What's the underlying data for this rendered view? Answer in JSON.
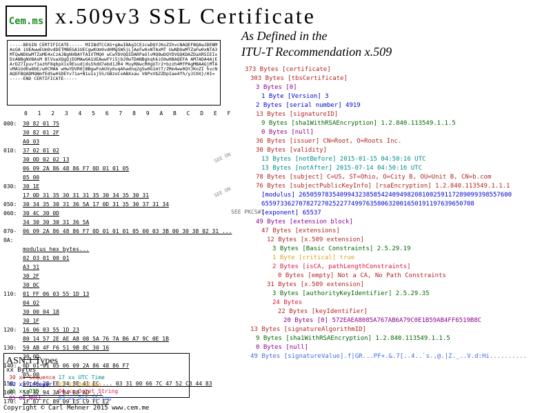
{
  "logo": {
    "text": "Cem.ms"
  },
  "title": "x.509v3 SSL Certificate",
  "subtitle1": "As Defined in the",
  "subtitle2": "ITU-T Recommendation x.509",
  "cert_pem": "-----BEGIN CERTIFICATE-----\nMIIBdTCCAS+gAwIBAgICEzcwDQYJKoZIhvcNAQEFBQAwJDENMAsGA\n1UEAwwEUm9vdDETMBEGA1UECgwKUm9vdHMgSW5jLjAeFw0xNTAxMT\nUwNDUwMTZaFw0xNTA3MTQwNDUwMTZaME4xCzAJBgNVBAYTA1VTMQ0\nwCwYDVQQIDARPaGlvMQ8wDQYDVQQKDAZDaXR5IEIxDzANBgNVBAsM\nBlVuaXQgQjEOMAwGA1UEAwwFYi5jb20wTDANBgkqhkiG9w0BAQEFA\nAM7ADA4AjEArDZ7Ipuvf1azhF8qbpXis9EsudjdsShdd7ebd1JR4\nMuyRNwcR0gUTr2+bzzh4MfPAgMBAAGjMTAvMA1UdEw8bE/w0CMAA\nwHwYDVR0jBBgwFoAUVy6uqAhadnq2g5w0G1mtT/ZRm4ww0QYJKoZI\nhvcNAQEFBQADMQBmfEdSw0SDEYv71a+N1u1sj55/GBzoCxABXxau\nV8PxVbZZDpIae4fh/yJC0X}/0I=\n-----END CERTIFICATE-----",
  "hexdump": {
    "header": "0 1 2 3 4 5 6 7 8 9 A B C D E F",
    "rows": [
      {
        "off": "000:",
        "hex": "30 82 01 75"
      },
      {
        "off": "",
        "hex": "         30 82 01 2F"
      },
      {
        "off": "",
        "hex": "                  A0 03"
      },
      {
        "off": "010:",
        "hex": "37                        02 01 02"
      },
      {
        "off": "",
        "hex": "   30 0D                           02 02 13"
      },
      {
        "off": "",
        "hex": "         06 09 2A 86 48 86 F7 0D 01 01 05"
      },
      {
        "off": "",
        "hex": "                                       05 00"
      },
      {
        "off": "030:",
        "hex": "30 1E"
      },
      {
        "off": "",
        "hex": "      17 0D 31 35 30 31 31 35 30 34 35 30 31"
      },
      {
        "off": "050:",
        "hex": "30 34 35 30 31 36 5A    17 0D 31 35 30 37 31 34"
      },
      {
        "off": "060:",
        "hex": "                  30 4C 30 0D"
      },
      {
        "off": "",
        "hex": "34 30 30 30 31 36 5A"
      },
      {
        "off": "070-0A:",
        "hex": "06 09 2A 86 48 86 F7 0D 01 01 01 05 00 03 3B 00 30 38 02 31 ..."
      },
      {
        "off": "",
        "hex": "modulus hex bytes..."
      },
      {
        "off": "",
        "hex": "                              02 03 01 00 01"
      },
      {
        "off": "",
        "hex": "               A3 31"
      },
      {
        "off": "",
        "hex": "                     30 2F"
      },
      {
        "off": "",
        "hex": "                           30 0C"
      },
      {
        "off": "110:",
        "hex": "01 FF         06 03 55 1D 13"
      },
      {
        "off": "",
        "hex": "      04 02"
      },
      {
        "off": "",
        "hex": "            30 00                    04 18"
      },
      {
        "off": "",
        "hex": "                  30 1F"
      },
      {
        "off": "120:",
        "hex": "16               06 03 55 1D 23"
      },
      {
        "off": "",
        "hex": "   80 14 57 2E AE A8 08 5A 76 7A B6 A7 9C 0E 1B"
      },
      {
        "off": "130:",
        "hex": "59 AB 4F F6 51 9B 8C    30 16"
      },
      {
        "off": "",
        "hex": "                        30 0D"
      },
      {
        "off": "140:",
        "hex": "0D 01 01 05       06 09 2A 86 48 86 F7"
      },
      {
        "off": "",
        "hex": "            05 00"
      },
      {
        "off": "150:",
        "hex": "50 46 28 EE 34 8E 41 EC ... 03 31 00 66 7C 47 52 C3 44 83"
      },
      {
        "off": "160:",
        "hex": "58 32 94 3A B4 B8 AD ..."
      },
      {
        "off": "170:",
        "hex": "1F 87 FC 89 09 E5 C9 FC E2"
      }
    ]
  },
  "tree": [
    {
      "t": "373 Bytes [certificate]",
      "c": "seq",
      "i": 0
    },
    {
      "t": "303 Bytes [tbsCertificate]",
      "c": "seq",
      "i": 1
    },
    {
      "t": "3 Bytes [0]",
      "c": "purple",
      "i": 2
    },
    {
      "t": "1 Byte [Version] 3",
      "c": "blue",
      "i": 3
    },
    {
      "t": "2 Bytes [serial number]  4919",
      "c": "blue",
      "i": 2
    },
    {
      "t": "13 Bytes [signatureID]",
      "c": "seq",
      "i": 2
    },
    {
      "t": "9 Bytes [sha1WithRSAEncryption] 1.2.840.113549.1.1.5",
      "c": "green",
      "i": 3
    },
    {
      "t": "0 Bytes [null]",
      "c": "purple",
      "i": 3
    },
    {
      "t": "36 Bytes [issuer] CN=Root, O=Roots Inc.",
      "c": "seq",
      "i": 2
    },
    {
      "t": "30 Bytes [validity]",
      "c": "seq",
      "i": 2
    },
    {
      "t": "13 Bytes [notBefore] 2015-01-15 04:50:16 UTC",
      "c": "teal",
      "i": 3
    },
    {
      "t": "13 Bytes [notAfter] 2015-07-14 04:50:16 UTC",
      "c": "teal",
      "i": 3
    },
    {
      "t": "78 Bytes [subject] C=US, ST=Ohio, O=City B, OU=Unit B, CN=b.com",
      "c": "seq",
      "i": 2
    },
    {
      "t": "76 Bytes [subjectPublicKeyInfo] [rsaEncryption] 1.2.840.113549.1.1.1",
      "c": "seq",
      "i": 2
    },
    {
      "t": "[modulus]  265059783540994323858542409498208100259117289099398557600",
      "c": "blue",
      "i": 3
    },
    {
      "t": "           655973362707827270252277499763580632001650191197639650708",
      "c": "blue",
      "i": 3
    },
    {
      "t": "[exponent] 65537",
      "c": "blue",
      "i": 3
    },
    {
      "t": "49 Bytes [extension block]",
      "c": "purple",
      "i": 2
    },
    {
      "t": "47 Bytes [extensions]",
      "c": "seq",
      "i": 3
    },
    {
      "t": "12 Bytes [x.509 extension]",
      "c": "seq",
      "i": 4
    },
    {
      "t": "3 Bytes [Basic Constraints] 2.5.29.19",
      "c": "green",
      "i": 5
    },
    {
      "t": "1 Byte [critical] true",
      "c": "gold",
      "i": 5
    },
    {
      "t": "2 Bytes [isCA, pathLengthConstraints]",
      "c": "oct",
      "i": 5
    },
    {
      "t": "0 Bytes [empty] Not a CA, No Path Constraints",
      "c": "seq",
      "i": 6
    },
    {
      "t": "31 Bytes [x.509 extension]",
      "c": "seq",
      "i": 4
    },
    {
      "t": "3 Bytes [authorityKeyIdentifier] 2.5.29.35",
      "c": "green",
      "i": 5
    },
    {
      "t": "24 Bytes",
      "c": "oct",
      "i": 5
    },
    {
      "t": "22 Bytes [keyIdentifier]",
      "c": "seq",
      "i": 6
    },
    {
      "t": "20 Bytes [0] 572EAEA8085A767AB6A79C0E1B59AB4FF6519B8C",
      "c": "purple",
      "i": 7
    },
    {
      "t": "13 Bytes  [signatureAlgorithmID]",
      "c": "seq",
      "i": 1
    },
    {
      "t": "9 Bytes [sha1WithRSAEncryption] 1.2.840.113549.1.1.5",
      "c": "green",
      "i": 2
    },
    {
      "t": "0 Bytes [null]",
      "c": "purple",
      "i": 2
    },
    {
      "t": "49 Bytes [signatureValue].f|GR...PF+.&.7[..4..`s.,@.|Z._..V.d:Hi..........",
      "c": "bit",
      "i": 1
    }
  ],
  "asn": {
    "title": "ASN.1 Types",
    "sub": "xx Bytes",
    "rows": [
      [
        "30 xx Sequence",
        "17 xx UTC Time"
      ],
      [
        "02 xx Integer",
        "01 01 Boolean"
      ],
      [
        "06 xx OID",
        "04 xx Octet String"
      ],
      [
        "05 00 NULL",
        "03 xx Bit String"
      ]
    ]
  },
  "copyright": "Copyright © Carl Mehner 2015    www.cem.me",
  "labels": {
    "seedn": "SEE DN",
    "seepkcs": "SEE\nPKCS#1"
  }
}
